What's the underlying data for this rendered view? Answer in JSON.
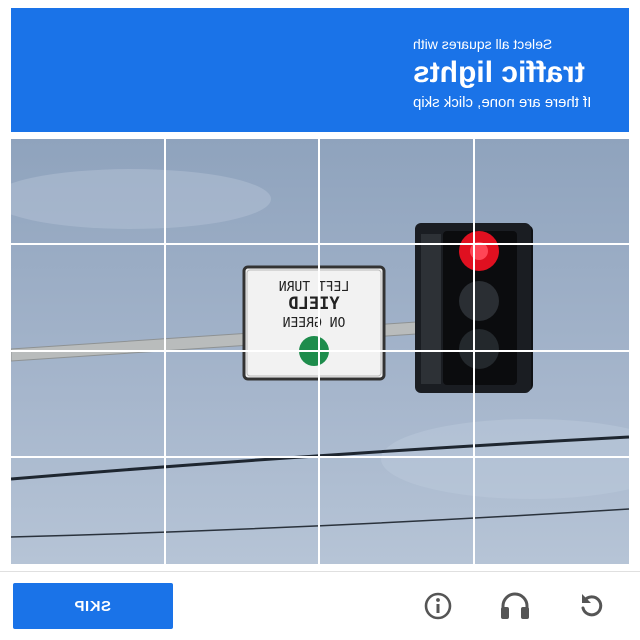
{
  "header": {
    "line1": "Select all squares with",
    "line2": "traffic lights",
    "line3": "If there are none, click skip",
    "bg_color": "#1a73e8"
  },
  "scene": {
    "sign_lines": [
      "LEFT TURN",
      "YIELD",
      "ON GREEN"
    ]
  },
  "grid": {
    "rows": 4,
    "cols": 4
  },
  "footer": {
    "skip_label": "SKIP",
    "icons": [
      "reload-icon",
      "audio-icon",
      "info-icon"
    ]
  }
}
